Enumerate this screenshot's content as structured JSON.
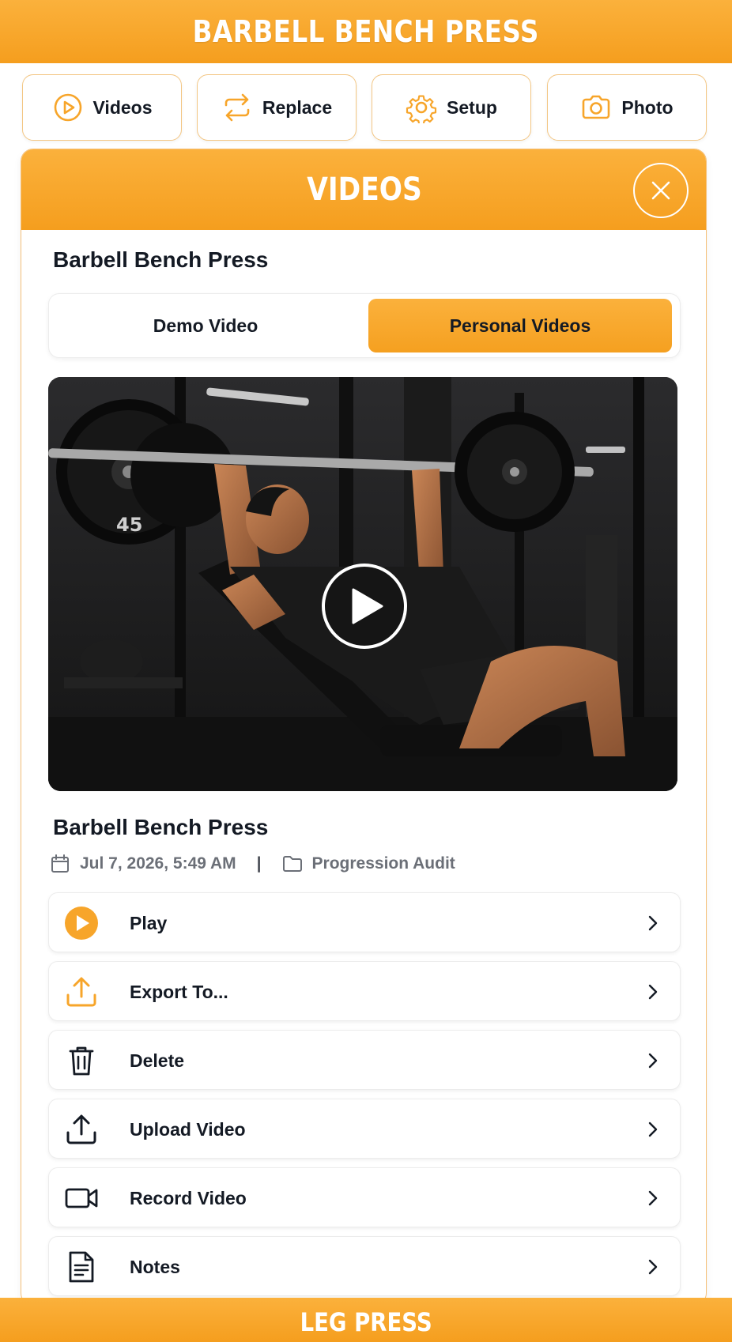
{
  "header": {
    "title": "BARBELL BENCH PRESS"
  },
  "toolbar": {
    "buttons": [
      {
        "label": "Videos",
        "icon": "play-circle-icon"
      },
      {
        "label": "Replace",
        "icon": "swap-arrows-icon"
      },
      {
        "label": "Setup",
        "icon": "gear-icon"
      },
      {
        "label": "Photo",
        "icon": "camera-icon"
      }
    ]
  },
  "modal": {
    "title": "VIDEOS",
    "exercise_name": "Barbell Bench Press",
    "tabs": [
      {
        "label": "Demo Video",
        "selected": false
      },
      {
        "label": "Personal Videos",
        "selected": true
      }
    ],
    "video": {
      "title": "Barbell Bench Press",
      "date": "Jul 7, 2026, 5:49 AM",
      "separator": "|",
      "folder": "Progression Audit",
      "plate_label": "45"
    },
    "actions": [
      {
        "label": "Play",
        "icon": "play-filled-icon"
      },
      {
        "label": "Export To...",
        "icon": "export-icon"
      },
      {
        "label": "Delete",
        "icon": "trash-icon"
      },
      {
        "label": "Upload Video",
        "icon": "upload-icon"
      },
      {
        "label": "Record Video",
        "icon": "video-camera-icon"
      },
      {
        "label": "Notes",
        "icon": "notes-icon"
      }
    ]
  },
  "bottom_bar": {
    "title": "LEG PRESS"
  },
  "colors": {
    "accent": "#f7a52a",
    "text": "#141a24",
    "muted": "#6b6f77",
    "border": "#ececec"
  }
}
